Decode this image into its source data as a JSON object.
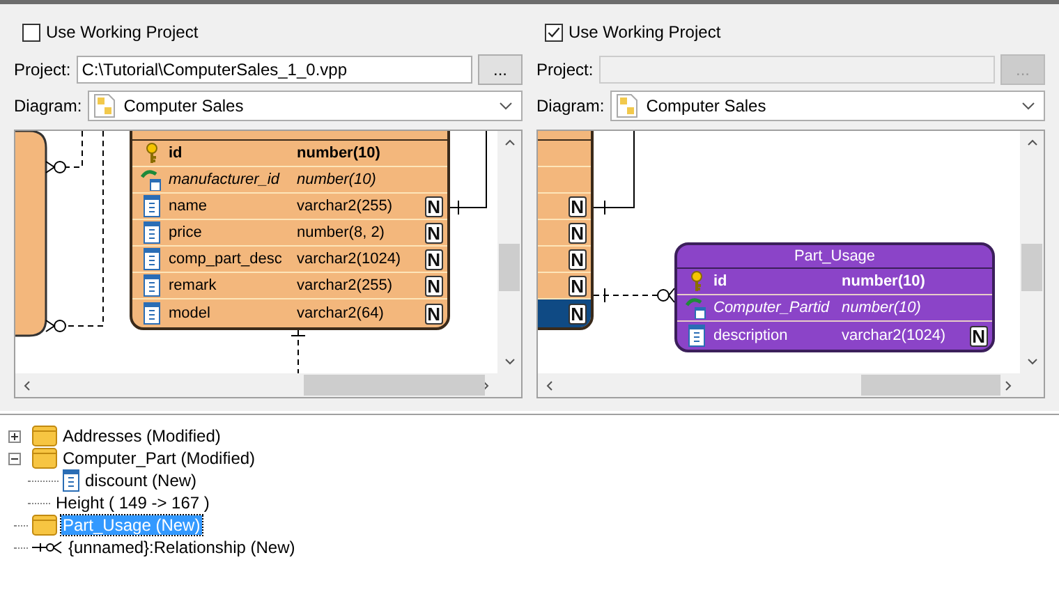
{
  "panes": [
    {
      "use_working_project": {
        "label": "Use Working Project",
        "checked": false
      },
      "project": {
        "label": "Project:",
        "value": "C:\\Tutorial\\ComputerSales_1_0.vpp",
        "browse": "...",
        "disabled": false
      },
      "diagram": {
        "label": "Diagram:",
        "value": "Computer Sales"
      },
      "entities": [
        {
          "kind": "entity",
          "color": "#f3b77c",
          "columns": [
            {
              "kind": "pk",
              "name": "id",
              "type": "number(10)"
            },
            {
              "kind": "fk",
              "name": "manufacturer_id",
              "type": "number(10)"
            },
            {
              "kind": "column",
              "name": "name",
              "type": "varchar2(255)",
              "null_mark": "N"
            },
            {
              "kind": "column",
              "name": "price",
              "type": "number(8, 2)",
              "null_mark": "N"
            },
            {
              "kind": "column",
              "name": "comp_part_desc",
              "type": "varchar2(1024)",
              "null_mark": "N"
            },
            {
              "kind": "column",
              "name": "remark",
              "type": "varchar2(255)",
              "null_mark": "N"
            },
            {
              "kind": "column",
              "name": "model",
              "type": "varchar2(64)",
              "null_mark": "N"
            }
          ]
        }
      ]
    },
    {
      "use_working_project": {
        "label": "Use Working Project",
        "checked": true
      },
      "project": {
        "label": "Project:",
        "browse": "...",
        "disabled": true
      },
      "diagram": {
        "label": "Diagram:",
        "value": "Computer Sales"
      },
      "entities": [
        {
          "kind": "partial",
          "color": "#f3b77c",
          "columns": [
            {
              "selected": false
            },
            {
              "selected": false
            },
            {
              "null_mark": "N",
              "selected": false
            },
            {
              "null_mark": "N",
              "selected": false
            },
            {
              "null_mark": "N",
              "selected": false
            },
            {
              "null_mark": "N",
              "selected": false
            },
            {
              "null_mark": "N",
              "selected": true
            }
          ]
        },
        {
          "kind": "entity",
          "color": "#8b44c8",
          "name": "Part_Usage",
          "columns": [
            {
              "kind": "pk",
              "name": "id",
              "type": "number(10)"
            },
            {
              "kind": "fk",
              "name": "Computer_Partid",
              "type": "number(10)"
            },
            {
              "kind": "column",
              "name": "description",
              "type": "varchar2(1024)",
              "null_mark": "N"
            }
          ]
        }
      ]
    }
  ],
  "tree": {
    "items": [
      {
        "kind": "table",
        "label": "Addresses (Modified)",
        "expanded": false,
        "selected": false
      },
      {
        "kind": "table",
        "label": "Computer_Part (Modified)",
        "expanded": true,
        "selected": false,
        "children": [
          {
            "kind": "column",
            "label": "discount (New)",
            "selected": false
          },
          {
            "kind": "property",
            "label": "Height ( 149 -> 167 )",
            "selected": false
          }
        ]
      },
      {
        "kind": "table",
        "label": "Part_Usage (New)",
        "selected": true
      },
      {
        "kind": "relationship",
        "label": "{unnamed}:Relationship (New)",
        "selected": false
      }
    ]
  }
}
